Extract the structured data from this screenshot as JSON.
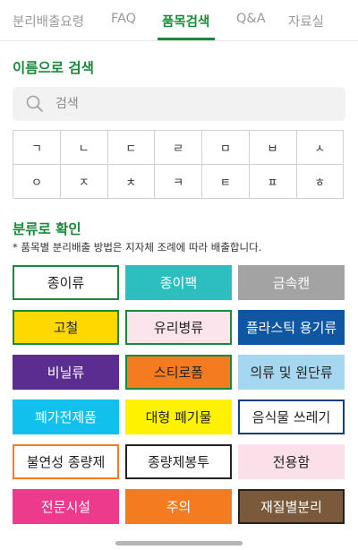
{
  "tabs": [
    {
      "label": "분리배출요령"
    },
    {
      "label": "FAQ"
    },
    {
      "label": "품목검색"
    },
    {
      "label": "Q&A"
    },
    {
      "label": "자료실"
    }
  ],
  "search_section": {
    "title": "이름으로 검색",
    "placeholder": "검색"
  },
  "consonants": [
    "ㄱ",
    "ㄴ",
    "ㄷ",
    "ㄹ",
    "ㅁ",
    "ㅂ",
    "ㅅ",
    "ㅇ",
    "ㅈ",
    "ㅊ",
    "ㅋ",
    "ㅌ",
    "ㅍ",
    "ㅎ"
  ],
  "category_section": {
    "title": "분류로 확인",
    "note": "* 품목별 분리배출 방법은 지자체 조례에 따라 배출합니다."
  },
  "categories": [
    {
      "label": "종이류",
      "bg": "#ffffff",
      "border": "#1a8a3a",
      "text": "#222222"
    },
    {
      "label": "종이팩",
      "bg": "#2dbfbf",
      "border": "#2dbfbf",
      "text": "#ffffff"
    },
    {
      "label": "금속캔",
      "bg": "#a3a3a3",
      "border": "#a3a3a3",
      "text": "#ffffff"
    },
    {
      "label": "고철",
      "bg": "#ffd800",
      "border": "#1a8a3a",
      "text": "#222222"
    },
    {
      "label": "유리병류",
      "bg": "#fbe4ec",
      "border": "#1a8a3a",
      "text": "#222222"
    },
    {
      "label": "플라스틱 용기류",
      "bg": "#0f56a3",
      "border": "#0f56a3",
      "text": "#ffffff"
    },
    {
      "label": "비닐류",
      "bg": "#5b2d91",
      "border": "#5b2d91",
      "text": "#ffffff"
    },
    {
      "label": "스티로폼",
      "bg": "#f47b20",
      "border": "#1a8a3a",
      "text": "#222222"
    },
    {
      "label": "의류 및 원단류",
      "bg": "#a5d8f0",
      "border": "#a5d8f0",
      "text": "#222222"
    },
    {
      "label": "폐가전제품",
      "bg": "#12c0ee",
      "border": "#12c0ee",
      "text": "#ffffff"
    },
    {
      "label": "대형 폐기물",
      "bg": "#fff200",
      "border": "#fff200",
      "text": "#222222"
    },
    {
      "label": "음식물 쓰레기",
      "bg": "#ffffff",
      "border": "#123e7a",
      "text": "#222222"
    },
    {
      "label": "불연성 종량제",
      "bg": "#ffffff",
      "border": "#f47b20",
      "text": "#222222"
    },
    {
      "label": "종량제봉투",
      "bg": "#ffffff",
      "border": "#222222",
      "text": "#222222"
    },
    {
      "label": "전용함",
      "bg": "#fbe0ea",
      "border": "#fbe0ea",
      "text": "#222222"
    },
    {
      "label": "전문시설",
      "bg": "#ee3a8c",
      "border": "#ee3a8c",
      "text": "#ffffff"
    },
    {
      "label": "주의",
      "bg": "#f47b20",
      "border": "#f47b20",
      "text": "#ffffff"
    },
    {
      "label": "재질별분리",
      "bg": "#7a5a3a",
      "border": "#222222",
      "text": "#ffffff"
    }
  ]
}
